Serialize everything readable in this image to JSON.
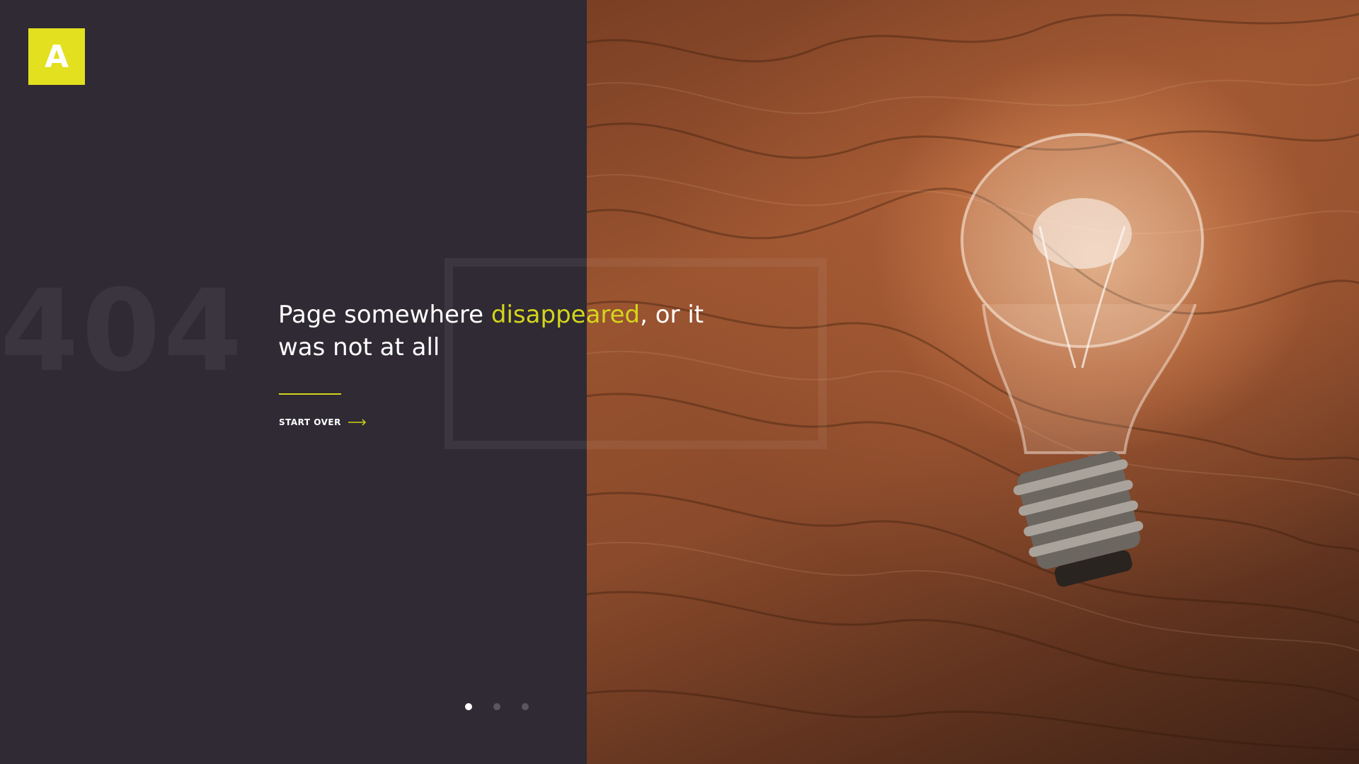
{
  "logo": {
    "letter": "A",
    "color": "#e2e01f"
  },
  "error": {
    "code": "404"
  },
  "headline": {
    "part1": "Page somewhere ",
    "highlight": "disappeared",
    "part2": ", or it was not at all"
  },
  "cta": {
    "label": "START OVER",
    "icon": "arrow-right-icon"
  },
  "pagination": {
    "count": 3,
    "active_index": 0
  },
  "colors": {
    "background": "#2f2a33",
    "accent": "#d4d51d",
    "text": "#ffffff"
  },
  "image": {
    "subject": "light-bulb-on-wood"
  }
}
